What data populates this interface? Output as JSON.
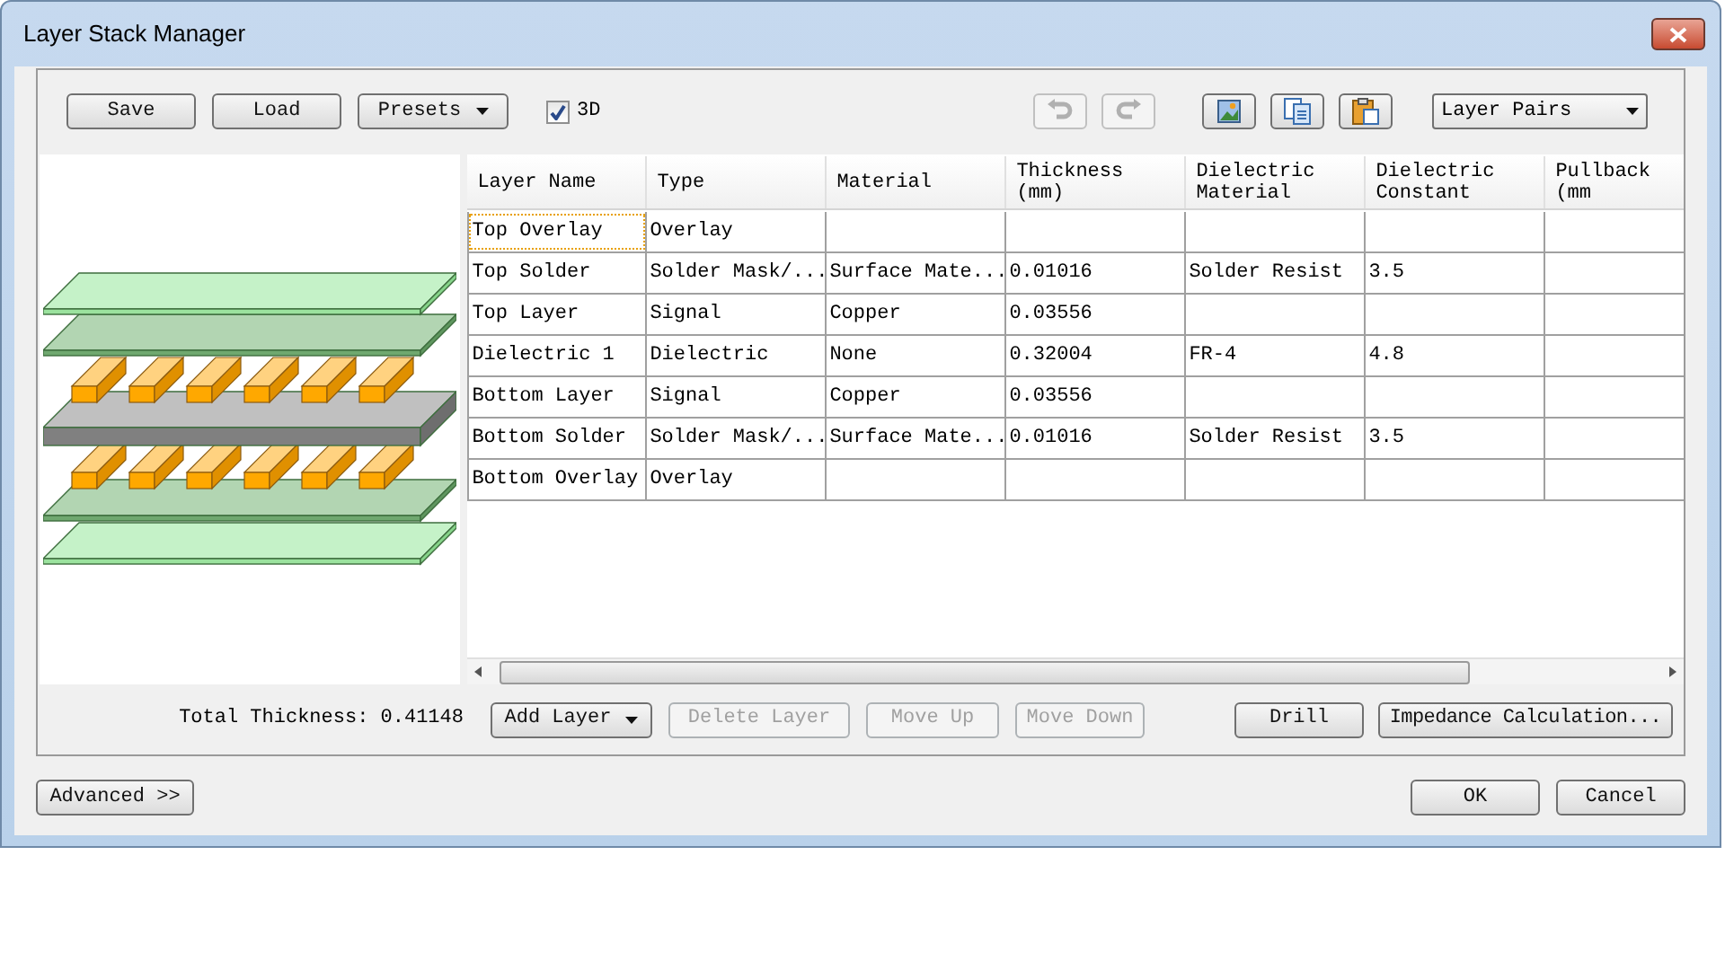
{
  "window": {
    "title": "Layer Stack Manager"
  },
  "toolbar": {
    "buttons": [
      {
        "label": "Save",
        "kind": "button"
      },
      {
        "label": "Load",
        "kind": "button"
      },
      {
        "label": "Presets",
        "kind": "dropdown"
      }
    ],
    "checkbox": {
      "label": "3D",
      "checked": true
    },
    "actions": [
      {
        "kind": "undo",
        "disabled": true
      },
      {
        "kind": "redo",
        "disabled": true
      },
      {
        "kind": "image",
        "disabled": false
      },
      {
        "kind": "copy",
        "disabled": false
      },
      {
        "kind": "paste",
        "disabled": false
      }
    ],
    "view_select": {
      "value": "Layer Pairs"
    }
  },
  "table": {
    "columns": [
      "Layer Name",
      "Type",
      "Material",
      "Thickness (mm)",
      "Dielectric Material",
      "Dielectric Constant",
      "Pullback (mm"
    ],
    "rows": [
      {
        "layer_name": "Top Overlay",
        "type": "Overlay",
        "selected": true
      },
      {
        "layer_name": "Top Solder",
        "type": "Solder Mask/...",
        "material": "Surface Mate...",
        "thickness": "0.01016",
        "dielectric_material": "Solder Resist",
        "dielectric_constant": "3.5",
        "selected": false
      },
      {
        "layer_name": "Top Layer",
        "type": "Signal",
        "material": "Copper",
        "thickness": "0.03556",
        "selected": false
      },
      {
        "layer_name": "Dielectric 1",
        "type": "Dielectric",
        "material": "None",
        "thickness": "0.32004",
        "dielectric_material": "FR-4",
        "dielectric_constant": "4.8",
        "selected": false
      },
      {
        "layer_name": "Bottom Layer",
        "type": "Signal",
        "material": "Copper",
        "thickness": "0.03556",
        "selected": false
      },
      {
        "layer_name": "Bottom Solder",
        "type": "Solder Mask/...",
        "material": "Surface Mate...",
        "thickness": "0.01016",
        "dielectric_material": "Solder Resist",
        "dielectric_constant": "3.5",
        "selected": false
      },
      {
        "layer_name": "Bottom Overlay",
        "type": "Overlay",
        "selected": false
      }
    ]
  },
  "total_thickness": "Total Thickness: 0.41148",
  "layer_buttons": [
    {
      "label": "Add Layer",
      "kind": "dropdown",
      "disabled": false
    },
    {
      "label": "Delete Layer",
      "kind": "button",
      "disabled": true
    },
    {
      "label": "Move Up",
      "kind": "button",
      "disabled": true
    },
    {
      "label": "Move Down",
      "kind": "button",
      "disabled": true
    }
  ],
  "calc_buttons": [
    {
      "label": "Drill"
    },
    {
      "label": "Impedance Calculation..."
    }
  ],
  "footer": {
    "advanced": "Advanced >>",
    "buttons": [
      "OK",
      "Cancel"
    ]
  }
}
